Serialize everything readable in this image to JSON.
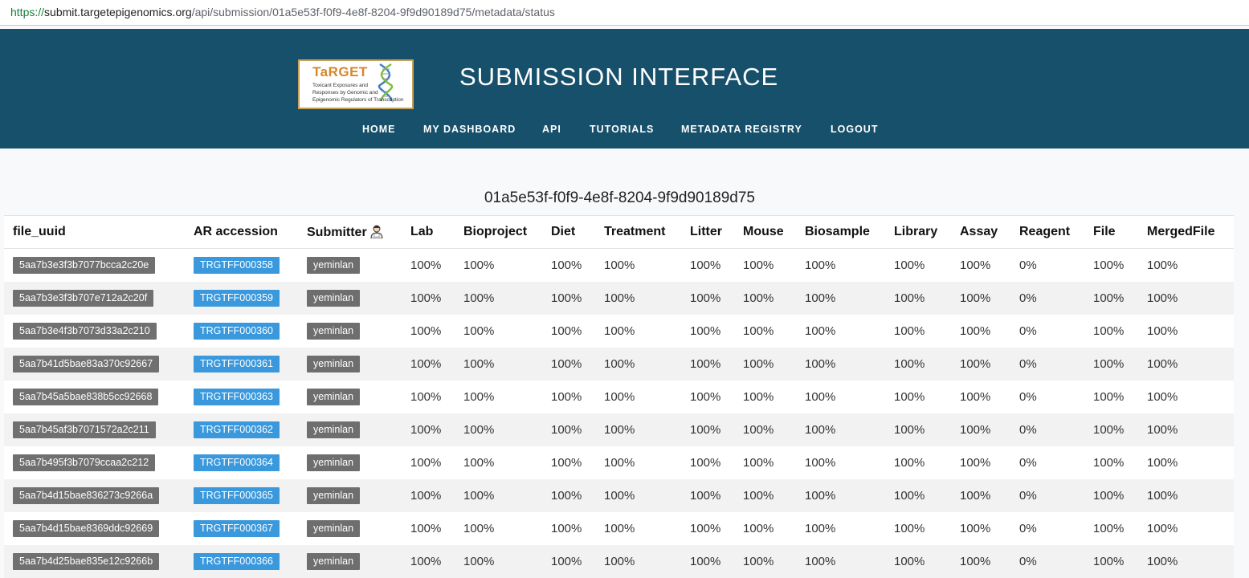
{
  "browser": {
    "url_scheme": "https://",
    "url_host": "submit.targetepigenomics.org",
    "url_path": "/api/submission/01a5e53f-f0f9-4e8f-8204-9f9d90189d75/metadata/status"
  },
  "header": {
    "logo": {
      "title": "TaRGET",
      "lines": [
        "Toxicant Exposures and",
        "Responses by Genomic and",
        "Epigenomic Regulators of Transcription"
      ]
    },
    "title": "SUBMISSION INTERFACE",
    "nav": [
      "HOME",
      "MY DASHBOARD",
      "API",
      "TUTORIALS",
      "METADATA REGISTRY",
      "LOGOUT"
    ]
  },
  "submission_id": "01a5e53f-f0f9-4e8f-8204-9f9d90189d75",
  "table": {
    "columns": [
      "file_uuid",
      "AR accession",
      "Submitter",
      "Lab",
      "Bioproject",
      "Diet",
      "Treatment",
      "Litter",
      "Mouse",
      "Biosample",
      "Library",
      "Assay",
      "Reagent",
      "File",
      "MergedFile"
    ],
    "submitter_icon": "person-icon",
    "rows": [
      {
        "file_uuid": "5aa7b3e3f3b7077bcca2c20e",
        "accession": "TRGTFF000358",
        "submitter": "yeminlan",
        "values": [
          "100%",
          "100%",
          "100%",
          "100%",
          "100%",
          "100%",
          "100%",
          "100%",
          "100%",
          "0%",
          "100%",
          "100%"
        ]
      },
      {
        "file_uuid": "5aa7b3e3f3b707e712a2c20f",
        "accession": "TRGTFF000359",
        "submitter": "yeminlan",
        "values": [
          "100%",
          "100%",
          "100%",
          "100%",
          "100%",
          "100%",
          "100%",
          "100%",
          "100%",
          "0%",
          "100%",
          "100%"
        ]
      },
      {
        "file_uuid": "5aa7b3e4f3b7073d33a2c210",
        "accession": "TRGTFF000360",
        "submitter": "yeminlan",
        "values": [
          "100%",
          "100%",
          "100%",
          "100%",
          "100%",
          "100%",
          "100%",
          "100%",
          "100%",
          "0%",
          "100%",
          "100%"
        ]
      },
      {
        "file_uuid": "5aa7b41d5bae83a370c92667",
        "accession": "TRGTFF000361",
        "submitter": "yeminlan",
        "values": [
          "100%",
          "100%",
          "100%",
          "100%",
          "100%",
          "100%",
          "100%",
          "100%",
          "100%",
          "0%",
          "100%",
          "100%"
        ]
      },
      {
        "file_uuid": "5aa7b45a5bae838b5cc92668",
        "accession": "TRGTFF000363",
        "submitter": "yeminlan",
        "values": [
          "100%",
          "100%",
          "100%",
          "100%",
          "100%",
          "100%",
          "100%",
          "100%",
          "100%",
          "0%",
          "100%",
          "100%"
        ]
      },
      {
        "file_uuid": "5aa7b45af3b7071572a2c211",
        "accession": "TRGTFF000362",
        "submitter": "yeminlan",
        "values": [
          "100%",
          "100%",
          "100%",
          "100%",
          "100%",
          "100%",
          "100%",
          "100%",
          "100%",
          "0%",
          "100%",
          "100%"
        ]
      },
      {
        "file_uuid": "5aa7b495f3b7079ccaa2c212",
        "accession": "TRGTFF000364",
        "submitter": "yeminlan",
        "values": [
          "100%",
          "100%",
          "100%",
          "100%",
          "100%",
          "100%",
          "100%",
          "100%",
          "100%",
          "0%",
          "100%",
          "100%"
        ]
      },
      {
        "file_uuid": "5aa7b4d15bae836273c9266a",
        "accession": "TRGTFF000365",
        "submitter": "yeminlan",
        "values": [
          "100%",
          "100%",
          "100%",
          "100%",
          "100%",
          "100%",
          "100%",
          "100%",
          "100%",
          "0%",
          "100%",
          "100%"
        ]
      },
      {
        "file_uuid": "5aa7b4d15bae8369ddc92669",
        "accession": "TRGTFF000367",
        "submitter": "yeminlan",
        "values": [
          "100%",
          "100%",
          "100%",
          "100%",
          "100%",
          "100%",
          "100%",
          "100%",
          "100%",
          "0%",
          "100%",
          "100%"
        ]
      },
      {
        "file_uuid": "5aa7b4d25bae835e12c9266b",
        "accession": "TRGTFF000366",
        "submitter": "yeminlan",
        "values": [
          "100%",
          "100%",
          "100%",
          "100%",
          "100%",
          "100%",
          "100%",
          "100%",
          "100%",
          "0%",
          "100%",
          "100%"
        ]
      }
    ]
  },
  "colors": {
    "header_bg": "#17506a",
    "accession_tag": "#3a98dc",
    "uuid_tag": "#707070",
    "logo_accent": "#d4872d"
  }
}
